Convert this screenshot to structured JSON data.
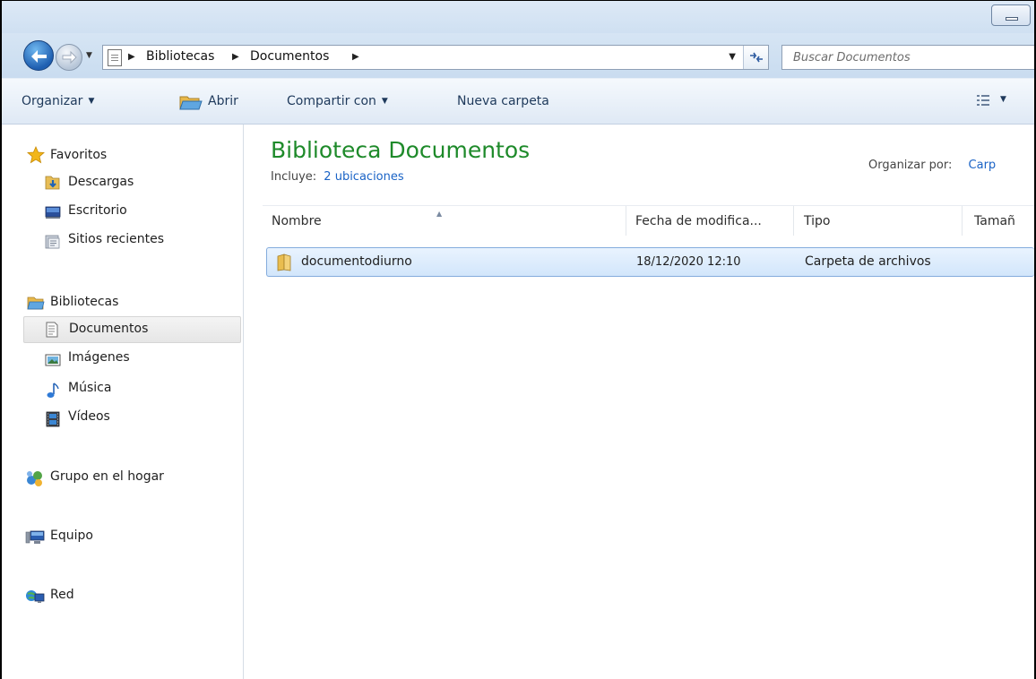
{
  "address": {
    "crumbs": [
      "Bibliotecas",
      "Documentos"
    ],
    "search_placeholder": "Buscar Documentos"
  },
  "toolbar": {
    "organizar": "Organizar",
    "abrir": "Abrir",
    "compartir": "Compartir con",
    "nueva_carpeta": "Nueva carpeta"
  },
  "nav": {
    "favoritos": "Favoritos",
    "descargas": "Descargas",
    "escritorio": "Escritorio",
    "sitios_recientes": "Sitios recientes",
    "bibliotecas": "Bibliotecas",
    "documentos": "Documentos",
    "imagenes": "Imágenes",
    "musica": "Música",
    "videos": "Vídeos",
    "grupo_hogar": "Grupo en el hogar",
    "equipo": "Equipo",
    "red": "Red"
  },
  "content": {
    "title": "Biblioteca Documentos",
    "incluye_label": "Incluye:",
    "incluye_link": "2 ubicaciones",
    "organizar_por_label": "Organizar por:",
    "organizar_por_value": "Carp"
  },
  "columns": {
    "nombre": "Nombre",
    "fecha": "Fecha de modifica...",
    "tipo": "Tipo",
    "tamano": "Tamañ"
  },
  "files": [
    {
      "name": "documentodiurno",
      "date": "18/12/2020 12:10",
      "type": "Carpeta de archivos"
    }
  ],
  "colors": {
    "title_green": "#1e8a2a",
    "link_blue": "#1a63c6",
    "selection_border": "#84acdd"
  }
}
